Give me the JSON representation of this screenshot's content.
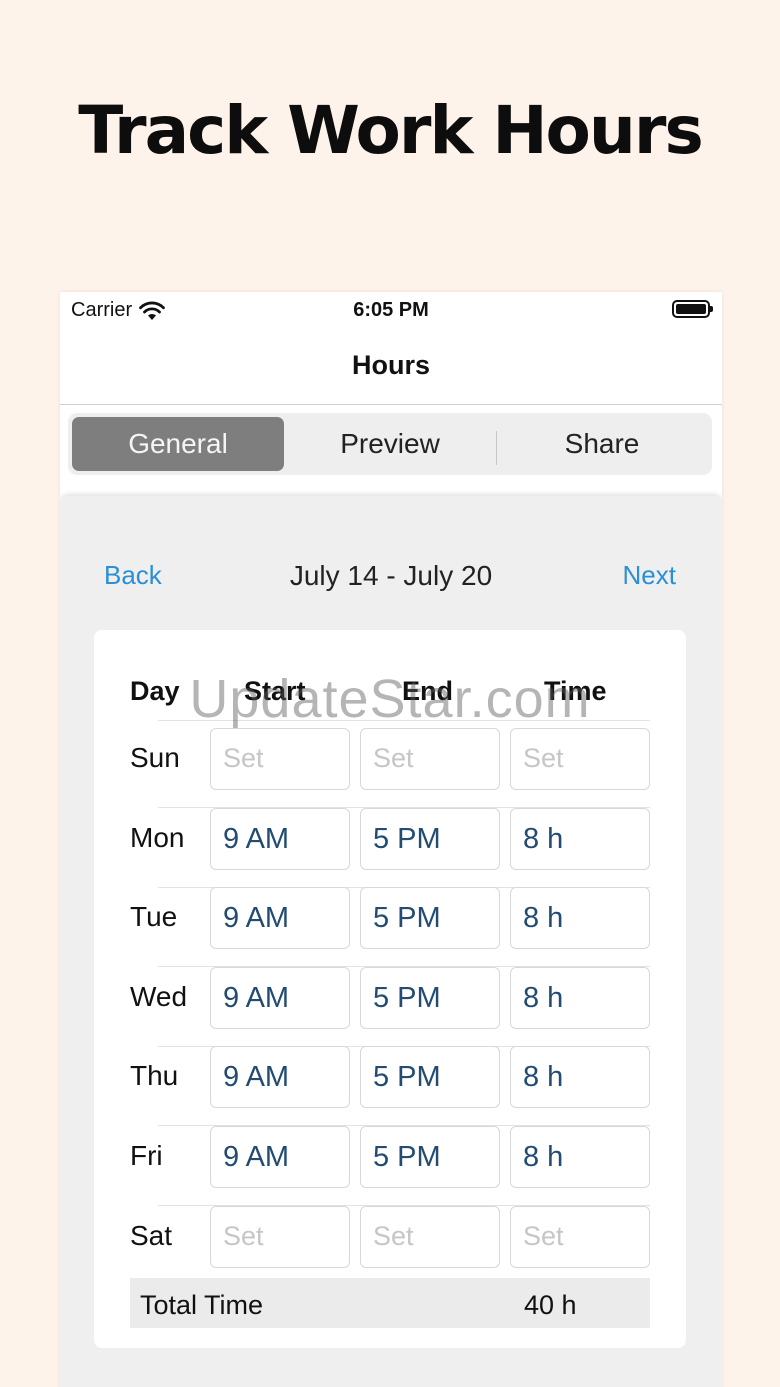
{
  "headline": "Track Work Hours",
  "status_bar": {
    "carrier": "Carrier",
    "time": "6:05 PM"
  },
  "nav": {
    "title": "Hours"
  },
  "segments": [
    {
      "label": "General",
      "active": true
    },
    {
      "label": "Preview",
      "active": false
    },
    {
      "label": "Share",
      "active": false
    }
  ],
  "week": {
    "back": "Back",
    "range": "July 14 - July 20",
    "next": "Next"
  },
  "table": {
    "headers": {
      "day": "Day",
      "start": "Start",
      "end": "End",
      "time": "Time"
    },
    "rows": [
      {
        "day": "Sun",
        "start": "Set",
        "end": "Set",
        "time": "Set",
        "empty": true
      },
      {
        "day": "Mon",
        "start": "9 AM",
        "end": "5 PM",
        "time": "8 h",
        "empty": false
      },
      {
        "day": "Tue",
        "start": "9 AM",
        "end": "5 PM",
        "time": "8 h",
        "empty": false
      },
      {
        "day": "Wed",
        "start": "9 AM",
        "end": "5 PM",
        "time": "8 h",
        "empty": false
      },
      {
        "day": "Thu",
        "start": "9 AM",
        "end": "5 PM",
        "time": "8 h",
        "empty": false
      },
      {
        "day": "Fri",
        "start": "9 AM",
        "end": "5 PM",
        "time": "8 h",
        "empty": false
      },
      {
        "day": "Sat",
        "start": "Set",
        "end": "Set",
        "time": "Set",
        "empty": true
      }
    ],
    "total_label": "Total Time",
    "total_value": "40 h"
  },
  "watermark": "UpdateStar.com",
  "colors": {
    "background": "#fdf3ea",
    "link": "#2a8fd6",
    "value_text": "#234c73",
    "active_segment": "#7e7e7e"
  }
}
